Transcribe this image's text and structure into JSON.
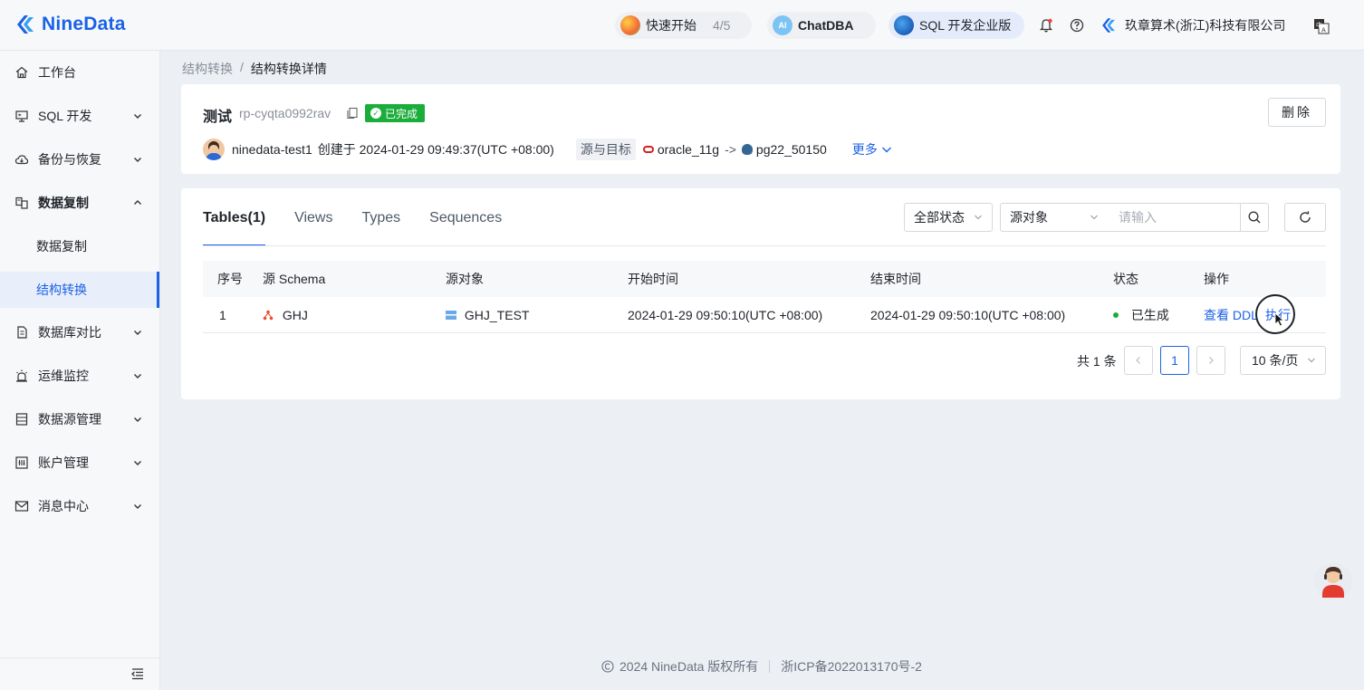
{
  "app": {
    "name": "NineData"
  },
  "topbar": {
    "quick_start_label": "快速开始",
    "quick_start_count": "4/5",
    "chatdba_label": "ChatDBA",
    "sql_edition_label": "SQL 开发企业版",
    "company_name": "玖章算术(浙江)科技有限公司"
  },
  "sidebar": {
    "items": [
      {
        "label": "工作台",
        "icon": "home-icon"
      },
      {
        "label": "SQL 开发",
        "icon": "monitor-icon"
      },
      {
        "label": "备份与恢复",
        "icon": "cloud-icon"
      },
      {
        "label": "数据复制",
        "icon": "replication-icon"
      },
      {
        "label": "数据复制",
        "icon": ""
      },
      {
        "label": "结构转换",
        "icon": ""
      },
      {
        "label": "数据库对比",
        "icon": "compare-icon"
      },
      {
        "label": "运维监控",
        "icon": "alarm-icon"
      },
      {
        "label": "数据源管理",
        "icon": "datasource-icon"
      },
      {
        "label": "账户管理",
        "icon": "account-icon"
      },
      {
        "label": "消息中心",
        "icon": "mail-icon"
      }
    ]
  },
  "breadcrumb": {
    "parent": "结构转换",
    "separator": "/",
    "current": "结构转换详情"
  },
  "task": {
    "name": "测试",
    "id": "rp-cyqta0992rav",
    "status": "已完成",
    "owner": "ninedata-test1",
    "created_text": "创建于 2024-01-29 09:49:37(UTC +08:00)",
    "source_target_label": "源与目标",
    "source_db": "oracle_11g",
    "arrow": "->",
    "target_db": "pg22_50150",
    "more_label": "更多",
    "delete_label": "删除"
  },
  "tabs": [
    {
      "label": "Tables(1)",
      "active": true
    },
    {
      "label": "Views",
      "active": false
    },
    {
      "label": "Types",
      "active": false
    },
    {
      "label": "Sequences",
      "active": false
    }
  ],
  "filters": {
    "status_select": "全部状态",
    "object_select": "源对象",
    "search_placeholder": "请输入"
  },
  "table": {
    "headers": [
      "序号",
      "源 Schema",
      "源对象",
      "开始时间",
      "结束时间",
      "状态",
      "操作"
    ],
    "rows": [
      {
        "index": "1",
        "schema": "GHJ",
        "object": "GHJ_TEST",
        "start_time": "2024-01-29 09:50:10(UTC +08:00)",
        "end_time": "2024-01-29 09:50:10(UTC +08:00)",
        "status": "已生成",
        "action_view": "查看 DDL",
        "action_exec": "执行"
      }
    ]
  },
  "pagination": {
    "total_text": "共 1 条",
    "current_page": "1",
    "page_size": "10 条/页"
  },
  "footer": {
    "copyright": "2024 NineData 版权所有",
    "icp": "浙ICP备2022013170号-2"
  },
  "colors": {
    "primary": "#1b62e6",
    "success": "#1aad3a"
  }
}
